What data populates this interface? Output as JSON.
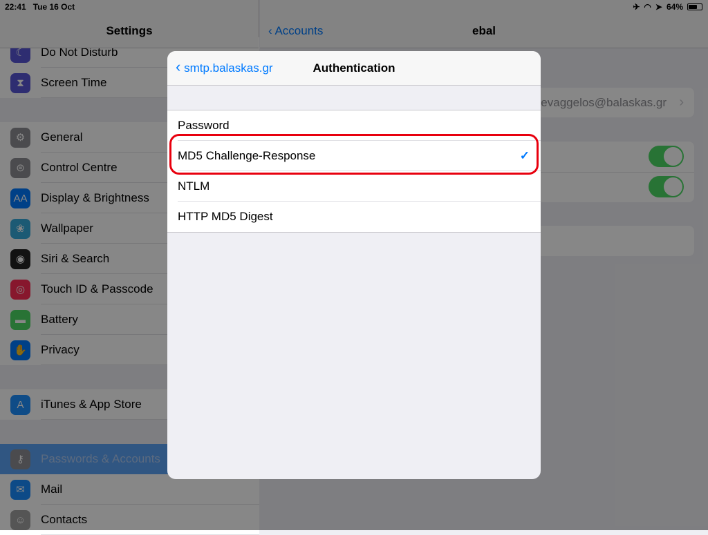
{
  "status": {
    "time": "22:41",
    "date": "Tue 16 Oct",
    "battery": "64%",
    "battery_level": 64
  },
  "sidebar": {
    "title": "Settings",
    "items": [
      {
        "label": "Do Not Disturb",
        "icon": "moon-icon",
        "color": "#5856d6",
        "glyph": "☾"
      },
      {
        "label": "Screen Time",
        "icon": "hourglass-icon",
        "color": "#5856d6",
        "glyph": "⧗"
      },
      {
        "label": "General",
        "icon": "gear-icon",
        "color": "#8e8e93",
        "glyph": "⚙"
      },
      {
        "label": "Control Centre",
        "icon": "switches-icon",
        "color": "#8e8e93",
        "glyph": "⊜"
      },
      {
        "label": "Display & Brightness",
        "icon": "text-size-icon",
        "color": "#007aff",
        "glyph": "AA"
      },
      {
        "label": "Wallpaper",
        "icon": "flower-icon",
        "color": "#35aadc",
        "glyph": "❀"
      },
      {
        "label": "Siri & Search",
        "icon": "siri-icon",
        "color": "#222",
        "glyph": "◉"
      },
      {
        "label": "Touch ID & Passcode",
        "icon": "fingerprint-icon",
        "color": "#ff2d55",
        "glyph": "◎"
      },
      {
        "label": "Battery",
        "icon": "battery-icon",
        "color": "#4cd964",
        "glyph": "▬"
      },
      {
        "label": "Privacy",
        "icon": "hand-icon",
        "color": "#007aff",
        "glyph": "✋"
      },
      {
        "label": "iTunes & App Store",
        "icon": "app-store-icon",
        "color": "#1e90ff",
        "glyph": "A"
      },
      {
        "label": "Passwords & Accounts",
        "icon": "key-icon",
        "color": "#8e8e93",
        "glyph": "⚷"
      },
      {
        "label": "Mail",
        "icon": "mail-icon",
        "color": "#1a8cff",
        "glyph": "✉"
      },
      {
        "label": "Contacts",
        "icon": "contacts-icon",
        "color": "#a0a0a0",
        "glyph": "☺"
      }
    ]
  },
  "detail": {
    "back": "Accounts",
    "title": "ebal",
    "email": "evaggelos@balaskas.gr",
    "toggles": [
      true,
      true
    ]
  },
  "modal": {
    "back": "smtp.balaskas.gr",
    "title": "Authentication",
    "options": [
      "Password",
      "MD5 Challenge-Response",
      "NTLM",
      "HTTP MD5 Digest"
    ],
    "selected": "MD5 Challenge-Response"
  },
  "colors": {
    "accent": "#007aff",
    "highlight": "#e8000e",
    "toggle_on": "#4cd964"
  }
}
